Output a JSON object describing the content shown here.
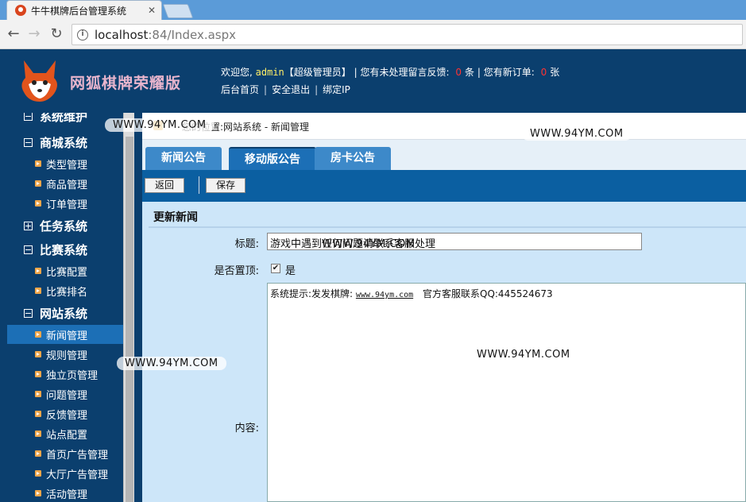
{
  "browser": {
    "tab_title": "牛牛棋牌后台管理系统",
    "tab_close": "✕",
    "url_host": "localhost",
    "url_rest": ":84/Index.aspx"
  },
  "header": {
    "brand": "网狐棋牌荣耀版",
    "welcome_prefix": "欢迎您,",
    "username": "admin",
    "role": "【超级管理员】",
    "feedback_prefix": "| 您有未处理留言反馈:",
    "feedback_count": "0",
    "feedback_unit": "条",
    "orders_prefix": "| 您有新订单:",
    "orders_count": "0",
    "orders_unit": "张",
    "links": [
      "后台首页",
      "安全退出",
      "绑定IP"
    ]
  },
  "sidebar": {
    "cut_group": "系统维护",
    "groups": [
      {
        "label": "商城系统",
        "expanded": true,
        "items": [
          "类型管理",
          "商品管理",
          "订单管理"
        ]
      },
      {
        "label": "任务系统",
        "expanded": false,
        "items": []
      },
      {
        "label": "比赛系统",
        "expanded": true,
        "items": [
          "比赛配置",
          "比赛排名"
        ]
      },
      {
        "label": "网站系统",
        "expanded": true,
        "items": [
          "新闻管理",
          "规则管理",
          "独立页管理",
          "问题管理",
          "反馈管理",
          "站点配置",
          "首页广告管理",
          "大厅广告管理",
          "活动管理"
        ]
      }
    ],
    "active_item": "新闻管理"
  },
  "content": {
    "breadcrumb": "您的位置:网站系统 - 新闻管理",
    "tabs": [
      "新闻公告",
      "移动版公告",
      "房卡公告"
    ],
    "active_tab": "移动版公告",
    "toolbar": {
      "back": "返回",
      "save": "保存"
    },
    "form_title": "更新新闻",
    "title_label": "标题:",
    "title_value": "游戏中遇到任何问题请联系客服处理",
    "pin_label": "是否置顶:",
    "pin_checked": true,
    "pin_text": "是",
    "content_label": "内容:",
    "content_prefix": "系统提示:发发棋牌:",
    "content_link": "www.94ym.com",
    "content_suffix": "官方客服联系QQ:445524673"
  },
  "watermark": "WWW.94YM.COM"
}
